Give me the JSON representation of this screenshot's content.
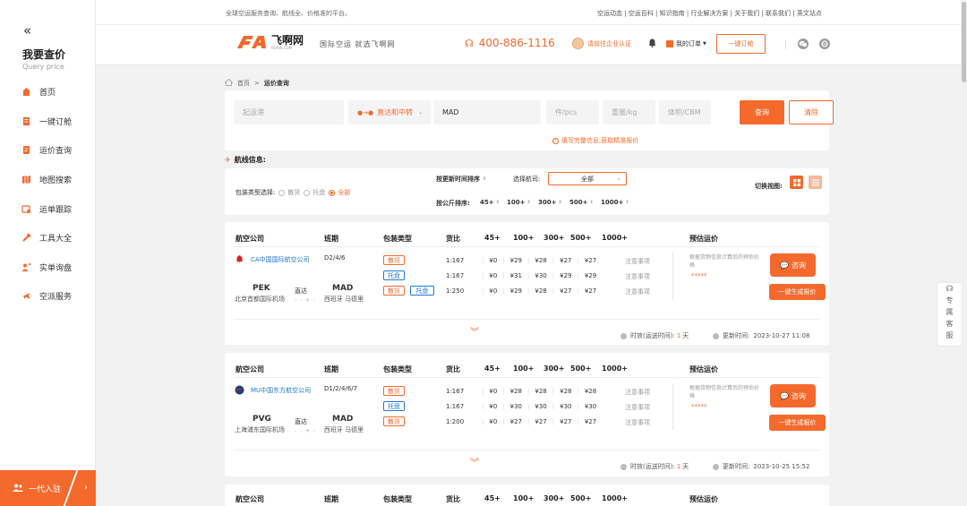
{
  "sidebar": {
    "collapse_icon": "«",
    "title": "我要查价",
    "subtitle": "Query price",
    "items": [
      {
        "label": "首页",
        "icon": "home-icon",
        "active": true
      },
      {
        "label": "一键订舱",
        "icon": "booking-icon"
      },
      {
        "label": "运价查询",
        "icon": "price-query-icon"
      },
      {
        "label": "地图搜索",
        "icon": "map-icon"
      },
      {
        "label": "运单跟踪",
        "icon": "tracking-icon"
      },
      {
        "label": "工具大全",
        "icon": "tools-icon"
      },
      {
        "label": "实单询盘",
        "icon": "inquiry-icon"
      },
      {
        "label": "空派服务",
        "icon": "air-delivery-icon"
      }
    ],
    "bottom_label": "一代入驻",
    "bottom_arrow": "›"
  },
  "topbar": {
    "slogan": "全球空运服务查询、航线全、价格准的平台。",
    "links": "空运动态 | 空运百科 | 知识指南 | 行业解决方案 | 关于我们 | 联系我们 | 英文站点"
  },
  "header": {
    "brand": "飞啊网",
    "domain": "FEIAIR.COM",
    "slogan": "国际空运  就选飞啊网",
    "phone": "400-886-1116",
    "cert": "请前往企业认证",
    "orders": "我的订单",
    "one_click": "一键订舱"
  },
  "breadcrumb": {
    "home": "首页",
    "sep": ">",
    "current": "运价查询"
  },
  "search": {
    "origin_placeholder": "起运港",
    "route_type": "直达和中转",
    "destination": "MAD",
    "pieces_placeholder": "件/pcs",
    "weight_placeholder": "重量/kg",
    "volume_placeholder": "体积/CBM",
    "query_label": "查询",
    "clear_label": "清除",
    "tip": "填写完整信息,获取精准报价"
  },
  "route_info_title": "航线信息:",
  "filters": {
    "pkg_label": "包装类型选择:",
    "pkg_options": [
      "散货",
      "托盘",
      "全部"
    ],
    "pkg_selected": "全部",
    "sort_time": "按更新时间排序",
    "airline_label": "选择航司:",
    "airline_value": "全部",
    "sort_weight": "按公斤排序:",
    "weight_breaks": [
      "45+",
      "100+",
      "300+",
      "500+",
      "1000+"
    ],
    "switch_view": "切换视图:"
  },
  "table_headers": {
    "airline": "航空公司",
    "schedule": "班期",
    "pkg": "包装类型",
    "ratio": "货比",
    "b45": "45+",
    "b100": "100+",
    "b300": "300+",
    "b500": "500+",
    "b1000": "1000+",
    "est": "预估运价"
  },
  "est_text": "根据货物信息计算后的预估价格",
  "stars": "*****",
  "consult": "咨询",
  "gen_quote": "一键生成报价",
  "notice": "注意事项",
  "direct": "直达",
  "validity_label": "时效(运送时间):",
  "validity_unit": "天",
  "updated_label": "更新时间:",
  "cards": [
    {
      "airline": "CA中国国际航空公司",
      "schedule": "D2/4/6",
      "from_code": "PEK",
      "from_city": "北京首都国际机场",
      "to_code": "MAD",
      "to_city": "西班牙 马德里",
      "rows": [
        {
          "tags": [
            "散货"
          ],
          "ratio": "1:167",
          "prices": [
            "¥0",
            "¥29",
            "¥28",
            "¥27",
            "¥27"
          ]
        },
        {
          "tags": [
            "托盘"
          ],
          "ratio": "1:167",
          "prices": [
            "¥0",
            "¥31",
            "¥30",
            "¥29",
            "¥29"
          ]
        },
        {
          "tags": [
            "散货",
            "托盘"
          ],
          "ratio": "1:250",
          "prices": [
            "¥0",
            "¥29",
            "¥28",
            "¥27",
            "¥27"
          ]
        }
      ],
      "validity": "1",
      "updated": "2023-10-27 11:08"
    },
    {
      "airline": "MU中国东方航空公司",
      "schedule": "D1/2/4/6/7",
      "from_code": "PVG",
      "from_city": "上海浦东国际机场",
      "to_code": "MAD",
      "to_city": "西班牙 马德里",
      "rows": [
        {
          "tags": [
            "散货"
          ],
          "ratio": "1:167",
          "prices": [
            "¥0",
            "¥28",
            "¥28",
            "¥28",
            "¥28"
          ]
        },
        {
          "tags": [
            "托盘"
          ],
          "ratio": "1:167",
          "prices": [
            "¥0",
            "¥30",
            "¥30",
            "¥30",
            "¥30"
          ]
        },
        {
          "tags": [
            "散货"
          ],
          "ratio": "1:200",
          "prices": [
            "¥0",
            "¥27",
            "¥27",
            "¥27",
            "¥27"
          ]
        }
      ],
      "validity": "1",
      "updated": "2023-10-25 15:52"
    }
  ],
  "float_panel": "专属客服",
  "colors": {
    "accent": "#f4692c",
    "link": "#1f78d1"
  }
}
